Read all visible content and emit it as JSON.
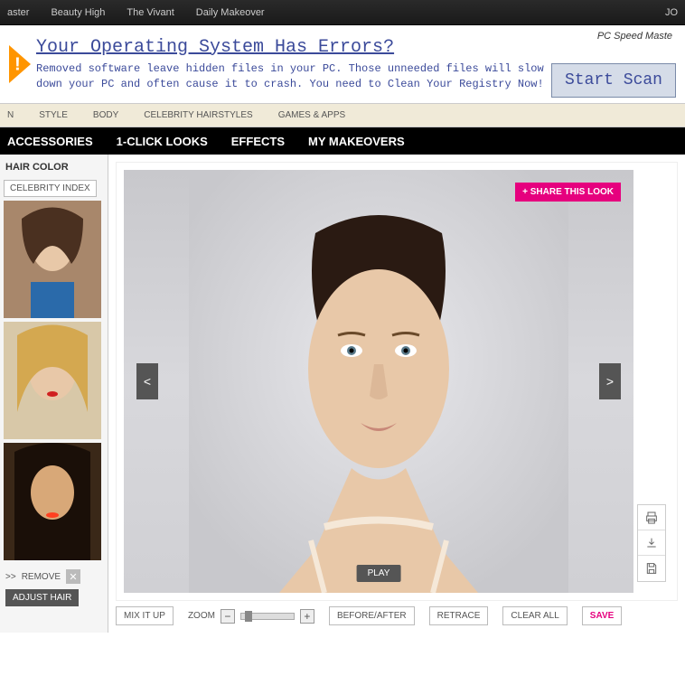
{
  "topbar": {
    "items": [
      "aster",
      "Beauty High",
      "The Vivant",
      "Daily Makeover"
    ],
    "right": "JO"
  },
  "ad": {
    "title": "Your Operating System Has Errors?",
    "body": "Removed software leave hidden files in your PC. Those unneeded files will slow down your PC and often cause it to crash. You need to Clean Your Registry Now!",
    "brand": "PC Speed Maste",
    "scan": "Start Scan"
  },
  "mainNav": {
    "items": [
      "N",
      "STYLE",
      "BODY",
      "CELEBRITY HAIRSTYLES",
      "GAMES & APPS"
    ]
  },
  "subNav": {
    "items": [
      "ACCESSORIES",
      "1-CLICK LOOKS",
      "EFFECTS",
      "MY MAKEOVERS"
    ]
  },
  "sidebar": {
    "title": "HAIR COLOR",
    "celebBtn": "CELEBRITY INDEX",
    "remove": "REMOVE",
    "arrows": ">>",
    "adjust": "ADJUST HAIR"
  },
  "editor": {
    "share": "+ SHARE THIS LOOK",
    "prev": "<",
    "next": ">",
    "play": "PLAY"
  },
  "bottom": {
    "mixItUp": "MIX IT UP",
    "zoom": "ZOOM",
    "beforeAfter": "BEFORE/AFTER",
    "retrace": "RETRACE",
    "clearAll": "CLEAR ALL",
    "save": "SAVE"
  }
}
